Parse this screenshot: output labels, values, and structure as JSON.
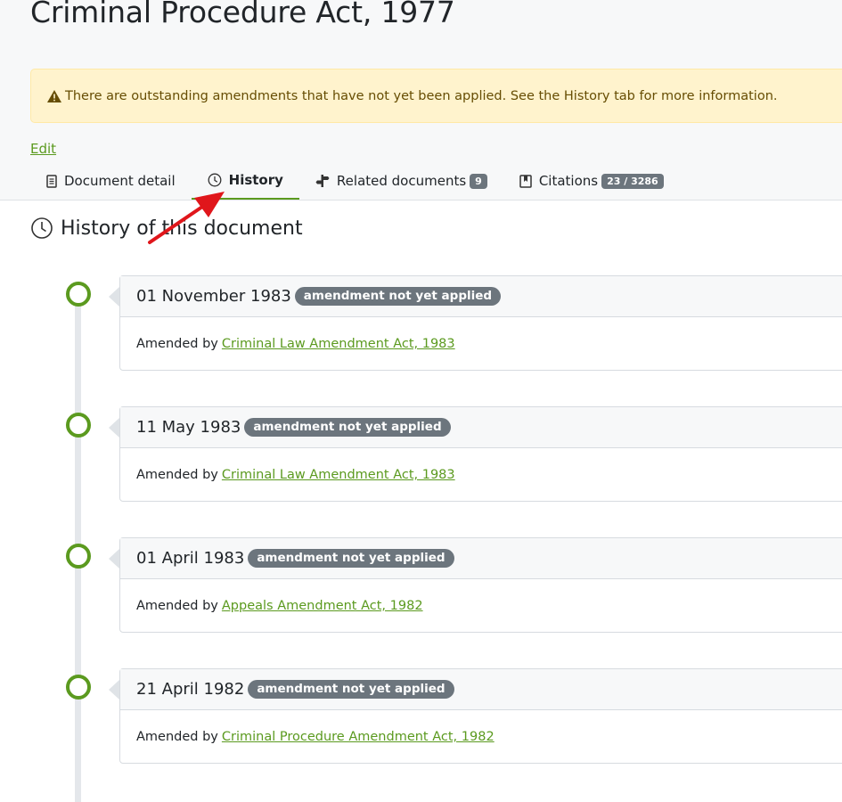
{
  "document": {
    "title": "Criminal Procedure Act, 1977"
  },
  "alert": {
    "icon": "warning-triangle-icon",
    "message": "There are outstanding amendments that have not yet been applied. See the History tab for more information."
  },
  "edit_label": "Edit",
  "tabs": [
    {
      "label": "Document detail",
      "icon": "document-icon",
      "badge": null
    },
    {
      "label": "History",
      "icon": "clock-icon",
      "badge": null,
      "active": true
    },
    {
      "label": "Related documents",
      "icon": "signpost-icon",
      "badge": "9"
    },
    {
      "label": "Citations",
      "icon": "bookmark-book-icon",
      "badge": "23 / 3286"
    }
  ],
  "history": {
    "heading": "History of this document",
    "events": [
      {
        "date": "01 November 1983",
        "status": "amendment not yet applied",
        "prefix": "Amended by",
        "link": "Criminal Law Amendment Act, 1983"
      },
      {
        "date": "11 May 1983",
        "status": "amendment not yet applied",
        "prefix": "Amended by",
        "link": "Criminal Law Amendment Act, 1983"
      },
      {
        "date": "01 April 1983",
        "status": "amendment not yet applied",
        "prefix": "Amended by",
        "link": "Appeals Amendment Act, 1982"
      },
      {
        "date": "21 April 1982",
        "status": "amendment not yet applied",
        "prefix": "Amended by",
        "link": "Criminal Procedure Amendment Act, 1982"
      }
    ]
  },
  "colors": {
    "accent_green": "#5b9a1f",
    "badge_gray": "#6c757d",
    "alert_bg": "#fff3cd",
    "annotation_arrow": "#e0161b"
  }
}
